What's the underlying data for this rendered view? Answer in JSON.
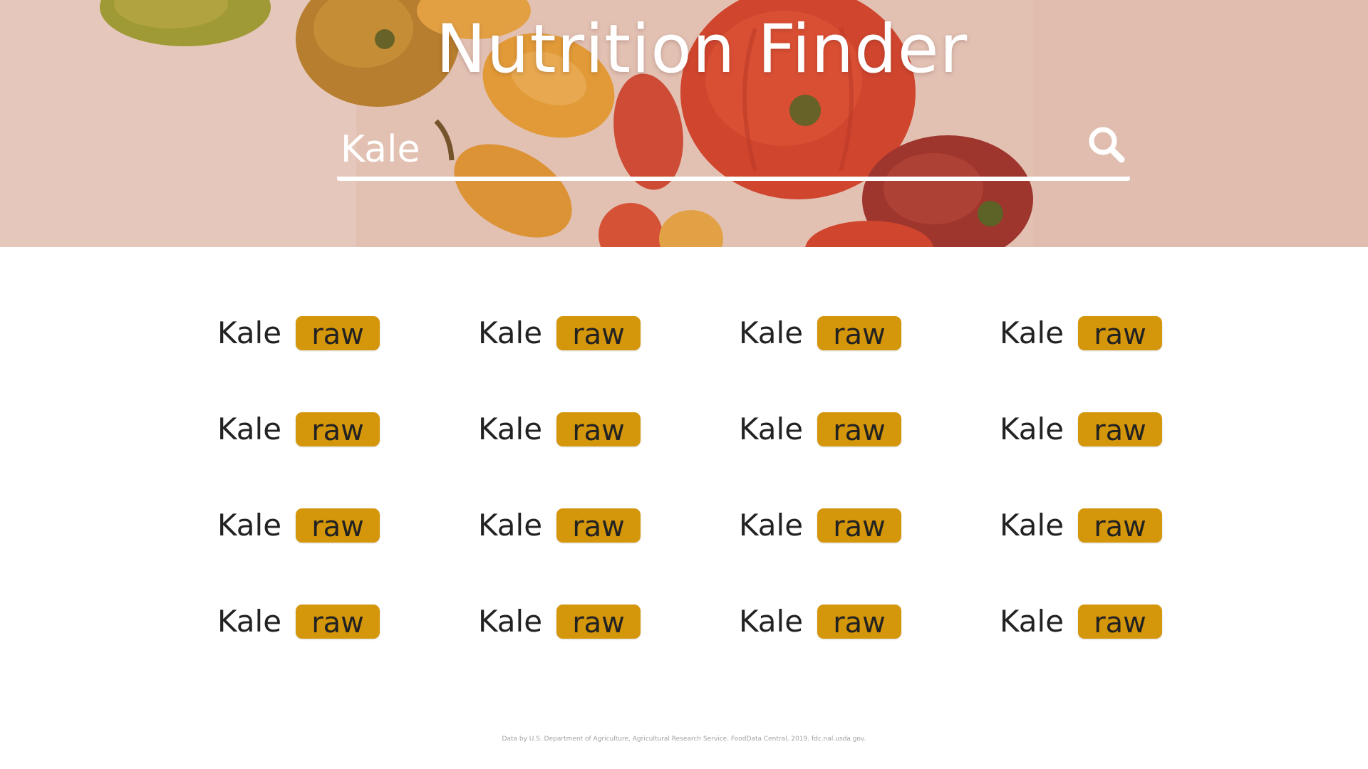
{
  "header": {
    "title": "Nutrition Finder"
  },
  "search": {
    "value": "Kale",
    "icon": "search-icon"
  },
  "results": {
    "items": [
      {
        "name": "Kale",
        "tag": "raw"
      },
      {
        "name": "Kale",
        "tag": "raw"
      },
      {
        "name": "Kale",
        "tag": "raw"
      },
      {
        "name": "Kale",
        "tag": "raw"
      },
      {
        "name": "Kale",
        "tag": "raw"
      },
      {
        "name": "Kale",
        "tag": "raw"
      },
      {
        "name": "Kale",
        "tag": "raw"
      },
      {
        "name": "Kale",
        "tag": "raw"
      },
      {
        "name": "Kale",
        "tag": "raw"
      },
      {
        "name": "Kale",
        "tag": "raw"
      },
      {
        "name": "Kale",
        "tag": "raw"
      },
      {
        "name": "Kale",
        "tag": "raw"
      },
      {
        "name": "Kale",
        "tag": "raw"
      },
      {
        "name": "Kale",
        "tag": "raw"
      },
      {
        "name": "Kale",
        "tag": "raw"
      },
      {
        "name": "Kale",
        "tag": "raw"
      }
    ]
  },
  "footer": {
    "credit": "Data by U.S. Department of Agriculture, Agricultural Research Service. FoodData Central, 2019. fdc.nal.usda.gov."
  },
  "colors": {
    "tag_background": "#d4960a",
    "hero_background": "#e4c5b8",
    "search_underline": "#ffffff"
  }
}
